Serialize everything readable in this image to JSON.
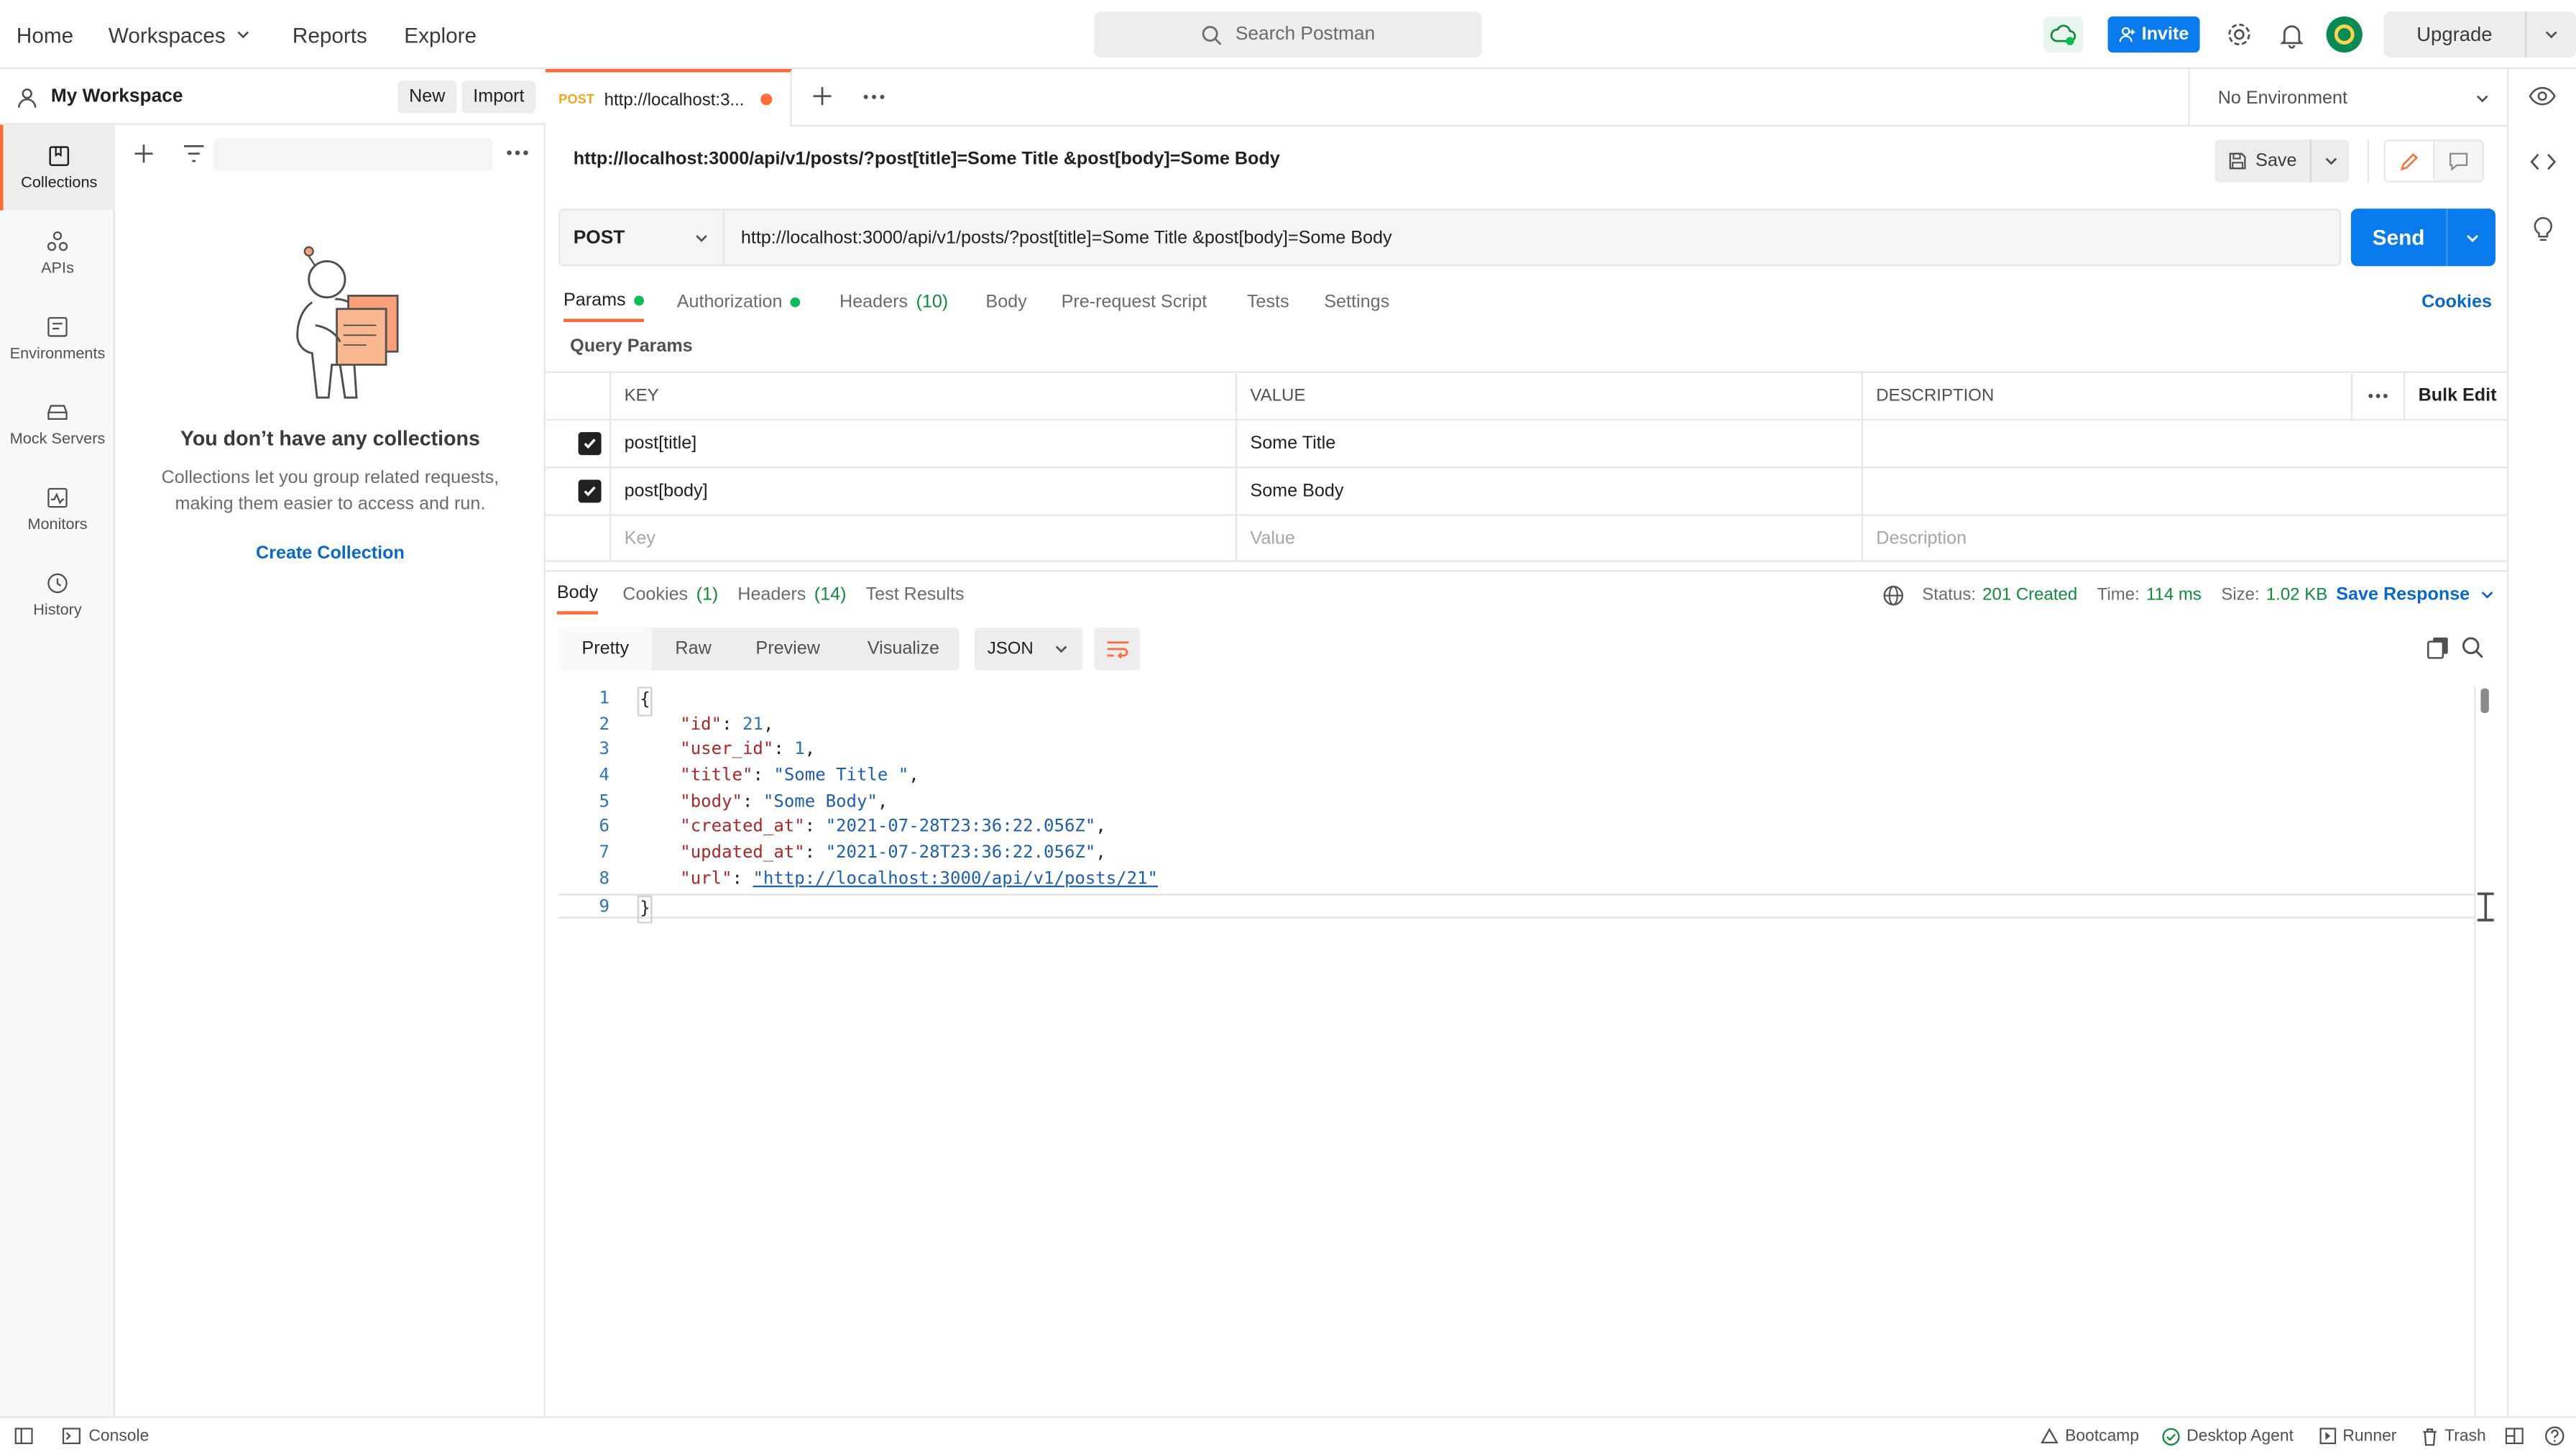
{
  "topbar": {
    "nav": [
      "Home",
      "Workspaces",
      "Reports",
      "Explore"
    ],
    "search_placeholder": "Search Postman",
    "invite_label": "Invite",
    "upgrade_label": "Upgrade"
  },
  "workspace": {
    "name": "My Workspace",
    "new_label": "New",
    "import_label": "Import"
  },
  "sidebar": {
    "items": [
      {
        "label": "Collections",
        "icon": "collections-icon"
      },
      {
        "label": "APIs",
        "icon": "apis-icon"
      },
      {
        "label": "Environments",
        "icon": "environments-icon"
      },
      {
        "label": "Mock Servers",
        "icon": "mock-servers-icon"
      },
      {
        "label": "Monitors",
        "icon": "monitors-icon"
      },
      {
        "label": "History",
        "icon": "history-icon"
      }
    ]
  },
  "collections": {
    "empty_title": "You don’t have any collections",
    "empty_desc_1": "Collections let you group related requests,",
    "empty_desc_2": "making them easier to access and run.",
    "create_label": "Create Collection"
  },
  "tab": {
    "method": "POST",
    "title": "http://localhost:3..."
  },
  "environment": {
    "selected": "No Environment"
  },
  "request": {
    "title": "http://localhost:3000/api/v1/posts/?post[title]=Some Title &post[body]=Some Body",
    "save_label": "Save",
    "method": "POST",
    "url": "http://localhost:3000/api/v1/posts/?post[title]=Some Title &post[body]=Some Body",
    "send_label": "Send",
    "tabs": {
      "params": "Params",
      "authorization": "Authorization",
      "headers": "Headers",
      "headers_count": "(10)",
      "body": "Body",
      "prerequest": "Pre-request Script",
      "tests": "Tests",
      "settings": "Settings"
    },
    "cookies_label": "Cookies",
    "query_params_title": "Query Params",
    "columns": {
      "key": "KEY",
      "value": "VALUE",
      "description": "DESCRIPTION",
      "bulk_edit": "Bulk Edit"
    },
    "params": [
      {
        "key": "post[title]",
        "value": "Some Title",
        "checked": true
      },
      {
        "key": "post[body]",
        "value": "Some Body",
        "checked": true
      }
    ],
    "placeholders": {
      "key": "Key",
      "value": "Value",
      "description": "Description"
    }
  },
  "response": {
    "tabs": {
      "body": "Body",
      "cookies": "Cookies",
      "cookies_count": "(1)",
      "headers": "Headers",
      "headers_count": "(14)",
      "test_results": "Test Results"
    },
    "status_label": "Status:",
    "status_value": "201 Created",
    "time_label": "Time:",
    "time_value": "114 ms",
    "size_label": "Size:",
    "size_value": "1.02 KB",
    "save_response_label": "Save Response",
    "views": [
      "Pretty",
      "Raw",
      "Preview",
      "Visualize"
    ],
    "format": "JSON",
    "lines": [
      {
        "num": "1",
        "open": "{"
      },
      {
        "num": "2",
        "key": "\"id\"",
        "value": "21",
        "type": "number",
        "comma": ","
      },
      {
        "num": "3",
        "key": "\"user_id\"",
        "value": "1",
        "type": "number",
        "comma": ","
      },
      {
        "num": "4",
        "key": "\"title\"",
        "value": "\"Some Title \"",
        "type": "string",
        "comma": ","
      },
      {
        "num": "5",
        "key": "\"body\"",
        "value": "\"Some Body\"",
        "type": "string",
        "comma": ","
      },
      {
        "num": "6",
        "key": "\"created_at\"",
        "value": "\"2021-07-28T23:36:22.056Z\"",
        "type": "string",
        "comma": ","
      },
      {
        "num": "7",
        "key": "\"updated_at\"",
        "value": "\"2021-07-28T23:36:22.056Z\"",
        "type": "string",
        "comma": ","
      },
      {
        "num": "8",
        "key": "\"url\"",
        "value": "\"http://localhost:3000/api/v1/posts/21\"",
        "type": "link",
        "comma": ""
      },
      {
        "num": "9",
        "open": "}"
      }
    ]
  },
  "footer": {
    "console": "Console",
    "bootcamp": "Bootcamp",
    "desktop_agent": "Desktop Agent",
    "runner": "Runner",
    "trash": "Trash"
  },
  "colors": {
    "accent": "#ff6c37",
    "primary": "#097bed",
    "status_green": "#0cbb52"
  }
}
